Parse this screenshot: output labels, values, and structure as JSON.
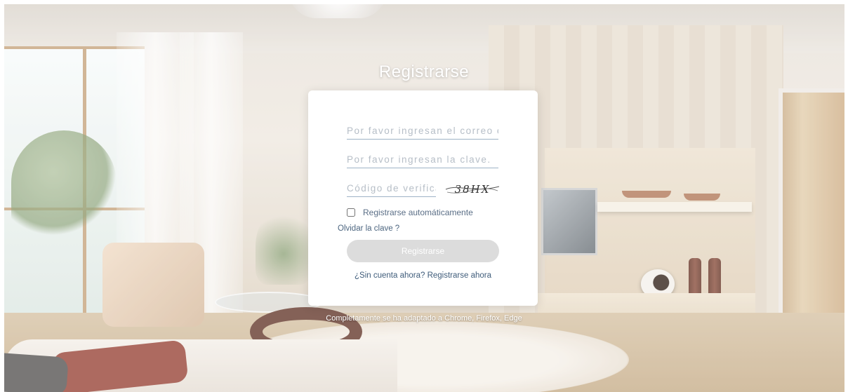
{
  "page": {
    "title": "Registrarse",
    "compat_note": "Completamente se ha adaptado a Chrome, Firefox, Edge"
  },
  "login": {
    "email_placeholder": "Por favor ingresan el correo electrónico.",
    "password_placeholder": "Por favor ingresan la clave.",
    "captcha_placeholder": "Código de verificación",
    "captcha_text": "38HX",
    "remember_label": "Registrarse automáticamente",
    "remember_checked": false,
    "forgot_link": "Olvidar la clave ?",
    "submit_label": "Registrarse",
    "no_account_text": "¿Sin cuenta ahora?",
    "register_link": "Registrarse ahora"
  },
  "colors": {
    "button_disabled": "#dcdcdc",
    "link_text": "#3f5c7a",
    "field_underline": "#9eb3c6"
  }
}
